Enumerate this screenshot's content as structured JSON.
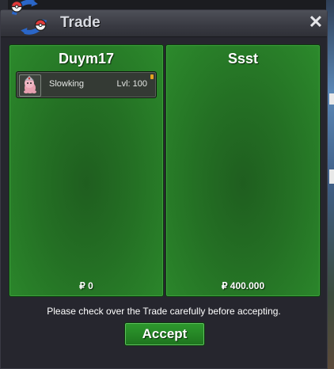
{
  "window": {
    "title": "Trade",
    "close_label": "✕"
  },
  "left_panel": {
    "player": "Duym17",
    "money": "₽ 0",
    "items": [
      {
        "name": "Slowking",
        "level": "Lvl: 100"
      }
    ]
  },
  "right_panel": {
    "player": "Ssst",
    "money": "₽ 400.000"
  },
  "notice": "Please check over the Trade carefully before accepting.",
  "accept_label": "Accept",
  "colors": {
    "panel_green": "#247024",
    "accept_green": "#2e9a2e",
    "title_bar": "#393a42"
  }
}
